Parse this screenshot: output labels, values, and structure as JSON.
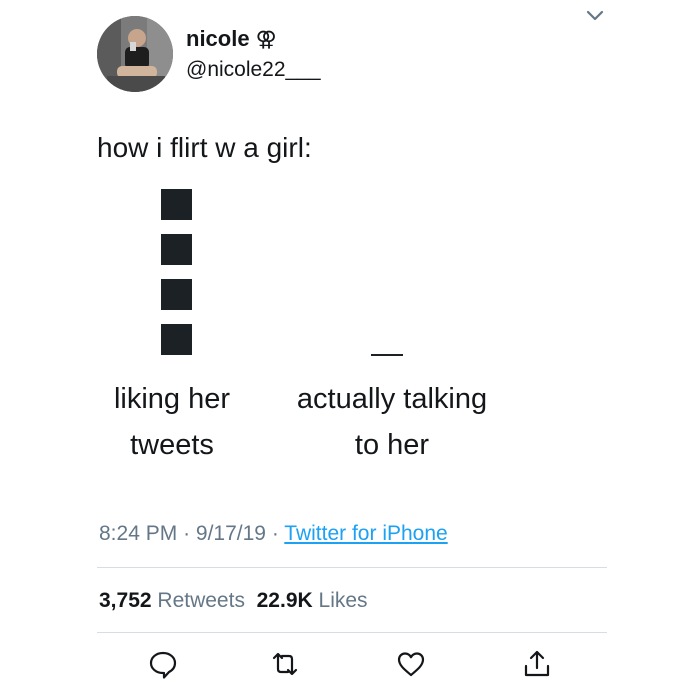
{
  "user": {
    "display_name": "nicole",
    "name_symbol": "⚢",
    "handle": "@nicole22___"
  },
  "tweet": {
    "text": "how i flirt w a girl:",
    "chart": {
      "left_label": [
        "liking her",
        "tweets"
      ],
      "right_label": [
        "actually talking",
        "to her"
      ],
      "left_block_count": 4
    }
  },
  "meta": {
    "time": "8:24 PM",
    "date": "9/17/19",
    "separator": "·",
    "source": "Twitter for iPhone"
  },
  "stats": {
    "retweets_count": "3,752",
    "retweets_label": "Retweets",
    "likes_count": "22.9K",
    "likes_label": "Likes"
  },
  "icons": {
    "reply": "reply-icon",
    "retweet": "retweet-icon",
    "like": "heart-icon",
    "share": "share-icon",
    "menu": "chevron-down-icon"
  }
}
